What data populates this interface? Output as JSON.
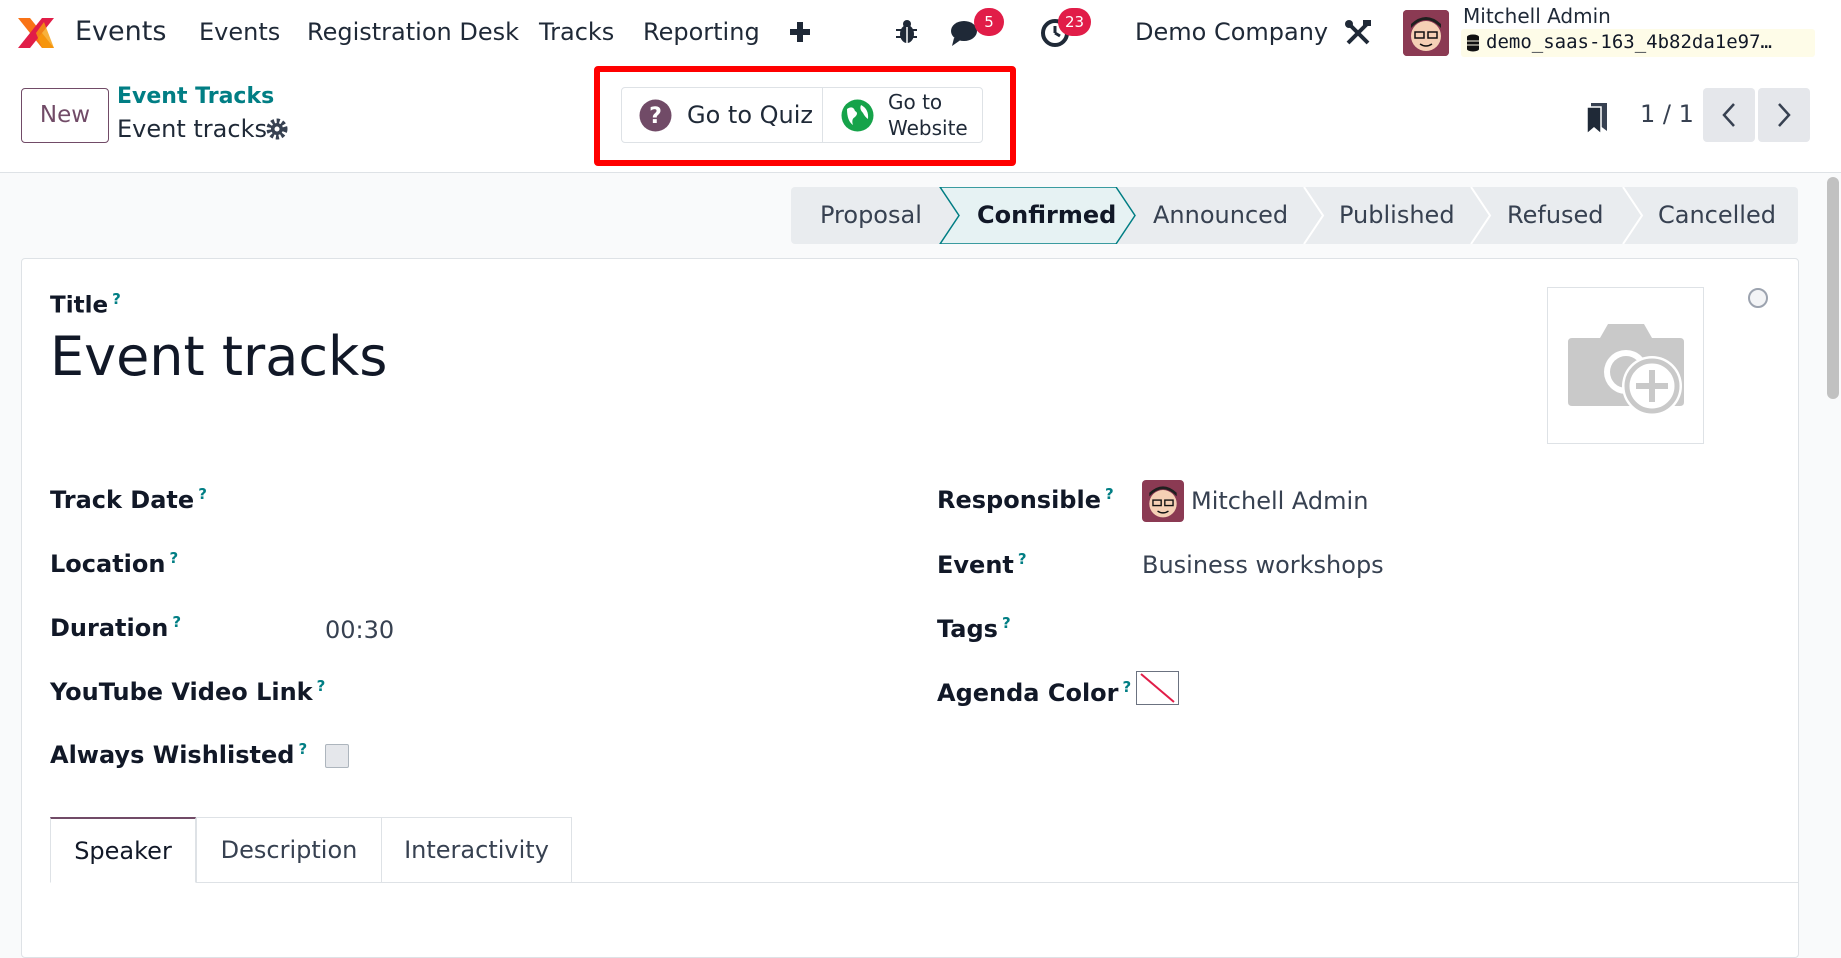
{
  "navbar": {
    "app_name": "Events",
    "menu": [
      "Events",
      "Registration Desk",
      "Tracks",
      "Reporting"
    ],
    "messages_count": "5",
    "activities_count": "23",
    "company": "Demo Company",
    "user_name": "Mitchell Admin",
    "database": "demo_saas-163_4b82da1e97…"
  },
  "control": {
    "new_label": "New",
    "breadcrumb_parent": "Event Tracks",
    "breadcrumb_current": "Event tracks",
    "quiz_label": "Go to Quiz",
    "website_label_line1": "Go to",
    "website_label_line2": "Website",
    "pager": "1 / 1"
  },
  "stages": [
    "Proposal",
    "Confirmed",
    "Announced",
    "Published",
    "Refused",
    "Cancelled"
  ],
  "active_stage": "Confirmed",
  "form": {
    "title_label": "Title",
    "title_value": "Event tracks",
    "help_mark": "?",
    "track_date_label": "Track Date",
    "location_label": "Location",
    "duration_label": "Duration",
    "duration_value": "00:30",
    "youtube_label": "YouTube Video Link",
    "wishlisted_label": "Always Wishlisted",
    "responsible_label": "Responsible",
    "responsible_value": "Mitchell Admin",
    "event_label": "Event",
    "event_value": "Business workshops",
    "tags_label": "Tags",
    "agenda_color_label": "Agenda Color"
  },
  "tabs": [
    "Speaker",
    "Description",
    "Interactivity"
  ],
  "colors": {
    "brand": "#714b67",
    "teal": "#017e84",
    "badge": "#e11d48",
    "highlight": "#ff0000"
  }
}
